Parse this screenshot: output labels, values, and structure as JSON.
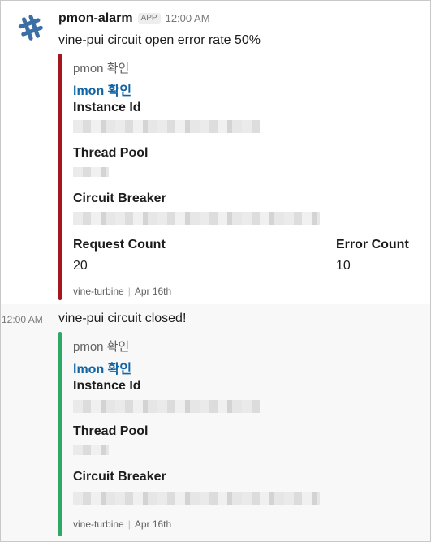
{
  "message1": {
    "app_name": "pmon-alarm",
    "app_badge": "APP",
    "time": "12:00 AM",
    "text": "vine-pui circuit open error rate 50%",
    "attachment": {
      "bar_color": "#a4161d",
      "pretext": "pmon 확인",
      "link": "lmon 확인",
      "fields": {
        "instance_id_title": "Instance Id",
        "thread_pool_title": "Thread Pool",
        "circuit_breaker_title": "Circuit Breaker",
        "request_count_title": "Request Count",
        "request_count_value": "20",
        "error_count_title": "Error Count",
        "error_count_value": "10"
      },
      "footer_source": "vine-turbine",
      "footer_date": "Apr 16th"
    }
  },
  "message2": {
    "time": "12:00 AM",
    "text": "vine-pui circuit closed!",
    "attachment": {
      "bar_color": "#2fa866",
      "pretext": "pmon 확인",
      "link": "lmon 확인",
      "fields": {
        "instance_id_title": "Instance Id",
        "thread_pool_title": "Thread Pool",
        "circuit_breaker_title": "Circuit Breaker"
      },
      "footer_source": "vine-turbine",
      "footer_date": "Apr 16th"
    }
  },
  "icons": {
    "avatar": "app-avatar-icon"
  }
}
